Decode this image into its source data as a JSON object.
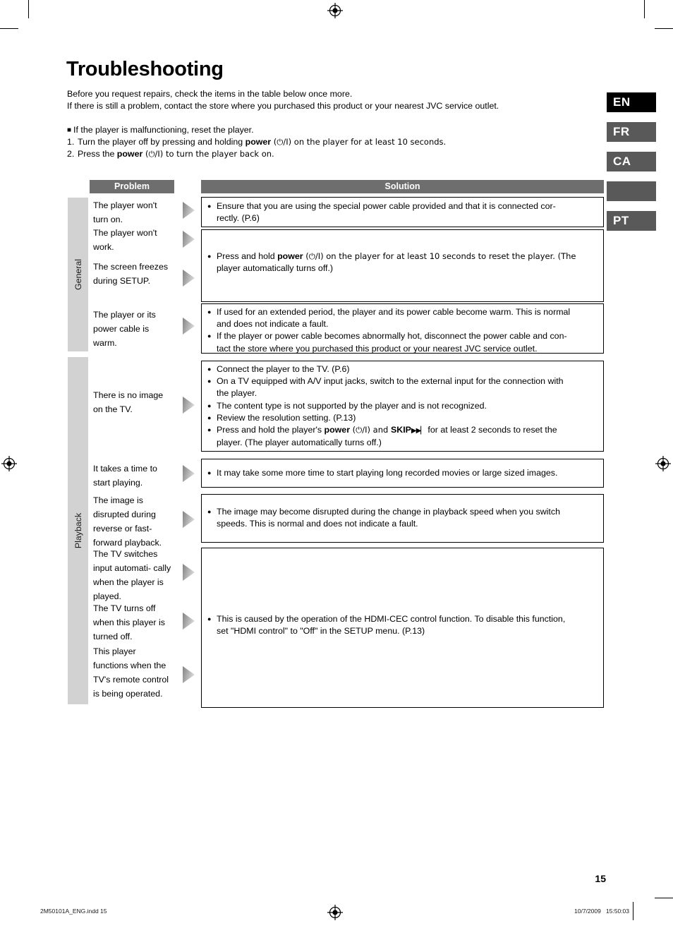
{
  "page": {
    "title": "Troubleshooting",
    "number": "15"
  },
  "intro": {
    "line1": "Before you request repairs, check the items in the table below once more.",
    "line2": "If there is still a problem, contact the store where you purchased this product or your nearest JVC service outlet."
  },
  "reset": {
    "heading": "If the player is malfunctioning, reset the player.",
    "step1_num": "1.",
    "step1_a": "Turn the player off by pressing and holding ",
    "step1_power": "power",
    "step1_b": " (⏻/I) on the player for at least 10 seconds.",
    "step2_num": "2.",
    "step2_a": "Press the ",
    "step2_power": "power",
    "step2_b": " (⏻/I) to turn the player back on."
  },
  "lang_tabs": [
    {
      "label": "EN",
      "active": true
    },
    {
      "label": "FR",
      "active": false
    },
    {
      "label": "CA",
      "active": false
    },
    {
      "label": "",
      "active": false
    },
    {
      "label": "PT",
      "active": false
    }
  ],
  "table": {
    "header_problem": "Problem",
    "header_solution": "Solution",
    "categories": [
      {
        "label": "General"
      },
      {
        "label": "Playback"
      }
    ],
    "problems": [
      "The player won't turn on.",
      "The player won't work.",
      "The screen freezes during SETUP.",
      "The player or its power cable is warm.",
      "There is no image on the TV.",
      "It takes a time to start playing.",
      "The image is disrupted during reverse or fast-forward playback.",
      "The TV switches input automati- cally when the player is played.",
      "The TV turns off when this player is turned off.",
      "This player functions when the TV's remote control is being operated."
    ],
    "solutions": {
      "s1_l1": "Ensure that you are using the special power cable provided and that it is connected cor-",
      "s1_l2": "rectly. (P.6)",
      "s2_a": "Press and hold ",
      "s2_power": "power",
      "s2_b": " (⏻/I) on the player for at least 10 seconds to reset the player. (The",
      "s2_l2": "player automatically turns off.)",
      "s3_b1_l1": "If used for an extended period, the player and its power cable become warm. This is normal",
      "s3_b1_l2": "and does not indicate a fault.",
      "s3_b2_l1": "If the player or power cable becomes abnormally hot, disconnect the power cable and con-",
      "s3_b2_l2": "tact the store where you purchased this product or your nearest JVC service outlet.",
      "s4_b1": "Connect the player to the TV. (P.6)",
      "s4_b2_l1": "On a TV equipped with A/V input jacks, switch to the external input for the connection with",
      "s4_b2_l2": "the player.",
      "s4_b3": "The content type is not supported by the player and is not recognized.",
      "s4_b4": "Review the resolution setting. (P.13)",
      "s4_b5_a": "Press and hold the player's ",
      "s4_b5_power": "power",
      "s4_b5_mid": " (⏻/I) and ",
      "s4_b5_skip": "SKIP",
      "s4_b5_icon": "▶▶▏",
      "s4_b5_b": " for at least 2 seconds to reset the",
      "s4_b5_l2": "player. (The player automatically turns off.)",
      "s5_b1": "It may take some more time to start playing long recorded movies or large sized images.",
      "s6_b1_l1": "The image may become disrupted during the change in playback speed when you switch",
      "s6_b1_l2": "speeds.  This is normal and does not indicate a fault.",
      "s7_b1_l1": "This is caused by the operation of the HDMI-CEC control function. To disable this function,",
      "s7_b1_l2": "set \"HDMI control\" to \"Off\" in the SETUP menu. (P.13)"
    }
  },
  "footer": {
    "file": "2M50101A_ENG.indd   15",
    "timestamp": "10/7/2009   15:50:03"
  }
}
